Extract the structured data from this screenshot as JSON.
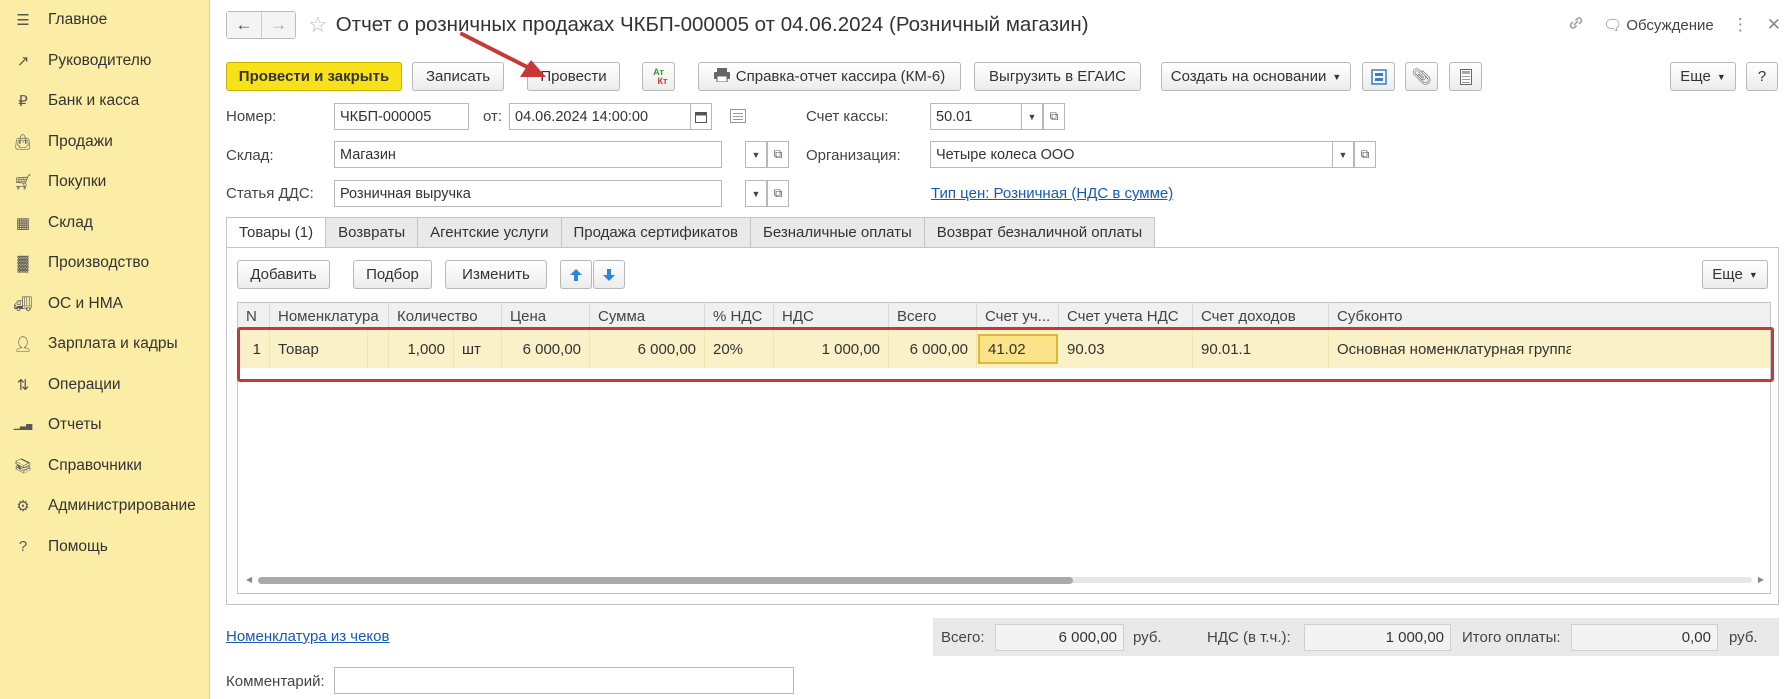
{
  "sidebar": {
    "items": [
      {
        "label": "Главное",
        "icon": "menu-icon"
      },
      {
        "label": "Руководителю",
        "icon": "trend-icon"
      },
      {
        "label": "Банк и касса",
        "icon": "coin-icon"
      },
      {
        "label": "Продажи",
        "icon": "bag-icon"
      },
      {
        "label": "Покупки",
        "icon": "cart-icon"
      },
      {
        "label": "Склад",
        "icon": "warehouse-icon"
      },
      {
        "label": "Производство",
        "icon": "factory-icon"
      },
      {
        "label": "ОС и НМА",
        "icon": "truck-icon"
      },
      {
        "label": "Зарплата и кадры",
        "icon": "person-icon"
      },
      {
        "label": "Операции",
        "icon": "dt-kt-icon"
      },
      {
        "label": "Отчеты",
        "icon": "bar-chart-icon"
      },
      {
        "label": "Справочники",
        "icon": "books-icon"
      },
      {
        "label": "Администрирование",
        "icon": "gear-icon"
      },
      {
        "label": "Помощь",
        "icon": "question-icon"
      }
    ]
  },
  "header": {
    "title": "Отчет о розничных продажах ЧКБП-000005 от 04.06.2024 (Розничный магазин)",
    "discussion": "Обсуждение"
  },
  "toolbar": {
    "post_close": "Провести и закрыть",
    "save": "Записать",
    "post": "Провести",
    "dtkt_top": "Ат",
    "dtkt_bottom": "Кт",
    "cashier_report": "Справка-отчет кассира (КМ-6)",
    "egais": "Выгрузить в ЕГАИС",
    "create_based": "Создать на основании",
    "more": "Еще",
    "help": "?"
  },
  "form": {
    "number_label": "Номер:",
    "number_value": "ЧКБП-000005",
    "date_label": "от:",
    "date_value": "04.06.2024 14:00:00",
    "cash_account_label": "Счет кассы:",
    "cash_account_value": "50.01",
    "warehouse_label": "Склад:",
    "warehouse_value": "Магазин",
    "org_label": "Организация:",
    "org_value": "Четыре колеса ООО",
    "dds_label": "Статья ДДС:",
    "dds_value": "Розничная выручка",
    "price_type_link": "Тип цен: Розничная (НДС в сумме)"
  },
  "tabs": [
    {
      "label": "Товары (1)",
      "active": true
    },
    {
      "label": "Возвраты",
      "active": false
    },
    {
      "label": "Агентские услуги",
      "active": false
    },
    {
      "label": "Продажа сертификатов",
      "active": false
    },
    {
      "label": "Безналичные оплаты",
      "active": false
    },
    {
      "label": "Возврат безналичной оплаты",
      "active": false
    }
  ],
  "table_toolbar": {
    "add": "Добавить",
    "pick": "Подбор",
    "edit": "Изменить",
    "more": "Еще"
  },
  "table": {
    "columns": [
      "N",
      "Номенклатура",
      "Количество",
      "Цена",
      "Сумма",
      "% НДС",
      "НДС",
      "Всего",
      "Счет уч...",
      "Счет учета НДС",
      "Счет доходов",
      "Субконто"
    ],
    "rows": [
      {
        "n": "1",
        "item": "Товар",
        "qty": "1,000",
        "unit": "шт",
        "price": "6 000,00",
        "sum": "6 000,00",
        "vat_rate": "20%",
        "vat": "1 000,00",
        "total": "6 000,00",
        "account": "41.02",
        "vat_account": "90.03",
        "income_account": "90.01.1",
        "subconto": "Основная номенклатурная группа"
      }
    ]
  },
  "footer": {
    "receipts_link": "Номенклатура из чеков",
    "total_label": "Всего:",
    "total_value": "6 000,00",
    "currency1": "руб.",
    "vat_label": "НДС (в т.ч.):",
    "vat_value": "1 000,00",
    "paid_label": "Итого оплаты:",
    "paid_value": "0,00",
    "currency2": "руб.",
    "comment_label": "Комментарий:",
    "comment_value": ""
  },
  "colors": {
    "sidebar_bg": "#fbeda6",
    "primary_button": "#f7e11b",
    "selected_row": "#fbf1c8",
    "link": "#1a58b5",
    "annotation": "#c73838"
  }
}
